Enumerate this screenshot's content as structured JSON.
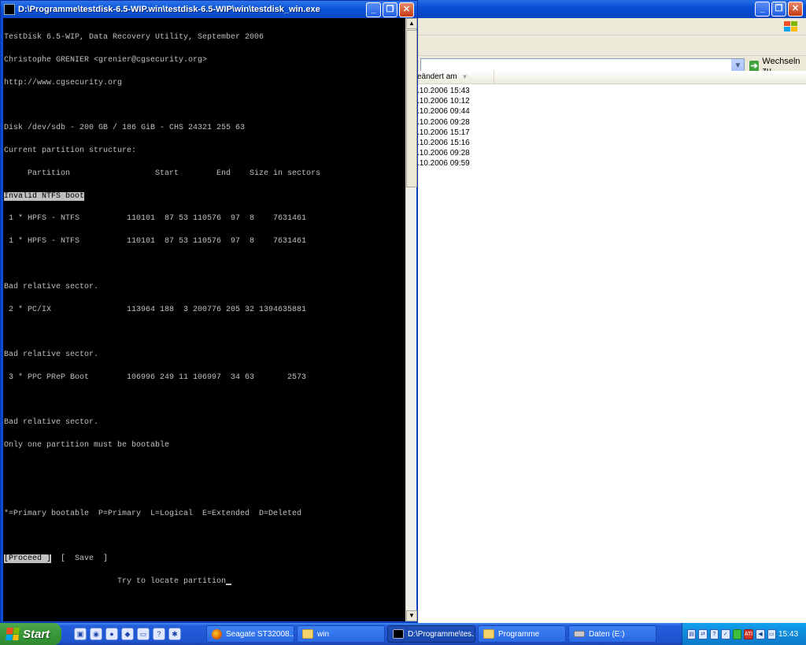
{
  "console": {
    "title": "D:\\Programme\\testdisk-6.5-WIP.win\\testdisk-6.5-WIP\\win\\testdisk_win.exe",
    "window_buttons": {
      "minimize": "_",
      "maximize": "❐",
      "close": "✕"
    },
    "lines": [
      "TestDisk 6.5-WIP, Data Recovery Utility, September 2006",
      "Christophe GRENIER <grenier@cgsecurity.org>",
      "http://www.cgsecurity.org",
      "",
      "Disk /dev/sdb - 200 GB / 186 GiB - CHS 24321 255 63",
      "Current partition structure:",
      "     Partition                  Start        End    Size in sectors"
    ],
    "highlight_line": "Invalid NTFS boot",
    "lines2": [
      " 1 * HPFS - NTFS          110101  87 53 110576  97  8    7631461",
      " 1 * HPFS - NTFS          110101  87 53 110576  97  8    7631461",
      "",
      "Bad relative sector.",
      " 2 * PC/IX                113964 188  3 200776 205 32 1394635881",
      "",
      "Bad relative sector.",
      " 3 * PPC PReP Boot        106996 249 11 106997  34 63       2573",
      "",
      "Bad relative sector.",
      "Only one partition must be bootable",
      "",
      "",
      "*=Primary bootable  P=Primary  L=Logical  E=Extended  D=Deleted",
      ""
    ],
    "menu_proceed": "[Proceed ]",
    "menu_save": "  [  Save  ]",
    "prompt": "                        Try to locate partition"
  },
  "explorer": {
    "window_buttons": {
      "minimize": "_",
      "maximize": "❐",
      "close": "✕"
    },
    "go_label": "Wechseln zu",
    "column_header": "eändert am",
    "rows": [
      ".10.2006 15:43",
      ".10.2006 10:12",
      ".10.2006 09:44",
      ".10.2006 09:28",
      ".10.2006 15:17",
      ".10.2006 15:16",
      ".10.2006 09:28",
      ".10.2006 09:59"
    ]
  },
  "taskbar": {
    "start_label": "Start",
    "tasks": [
      {
        "label": "Seagate ST32008...",
        "icon": "firefox-icon",
        "active": false
      },
      {
        "label": "win",
        "icon": "folder-icon",
        "active": false
      },
      {
        "label": "D:\\Programme\\tes...",
        "icon": "console-icon",
        "active": true
      },
      {
        "label": "Programme",
        "icon": "folder-icon",
        "active": false
      },
      {
        "label": "Daten (E:)",
        "icon": "drive-icon",
        "active": false
      }
    ],
    "tray_ati": "ATI",
    "clock": "15:43"
  }
}
